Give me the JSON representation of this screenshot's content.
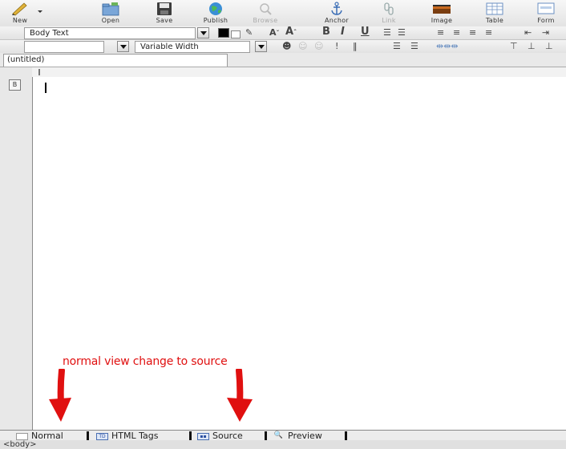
{
  "toolbar": {
    "buttons": [
      {
        "label": "New"
      },
      {
        "label": "Open"
      },
      {
        "label": "Save"
      },
      {
        "label": "Publish"
      },
      {
        "label": "Browse"
      },
      {
        "label": "Anchor"
      },
      {
        "label": "Link"
      },
      {
        "label": "Image"
      },
      {
        "label": "Table"
      },
      {
        "label": "Form"
      }
    ]
  },
  "format_bar": {
    "paragraph_style": "Body Text",
    "font": "Variable Width"
  },
  "document": {
    "tab_title": "(untitled)"
  },
  "annotation": {
    "text": "normal view change to source",
    "color": "#e01010"
  },
  "view_tabs": [
    {
      "label": "Normal"
    },
    {
      "label": "HTML Tags"
    },
    {
      "label": "Source"
    },
    {
      "label": "Preview"
    }
  ],
  "status_bar": {
    "text": "<body>"
  }
}
